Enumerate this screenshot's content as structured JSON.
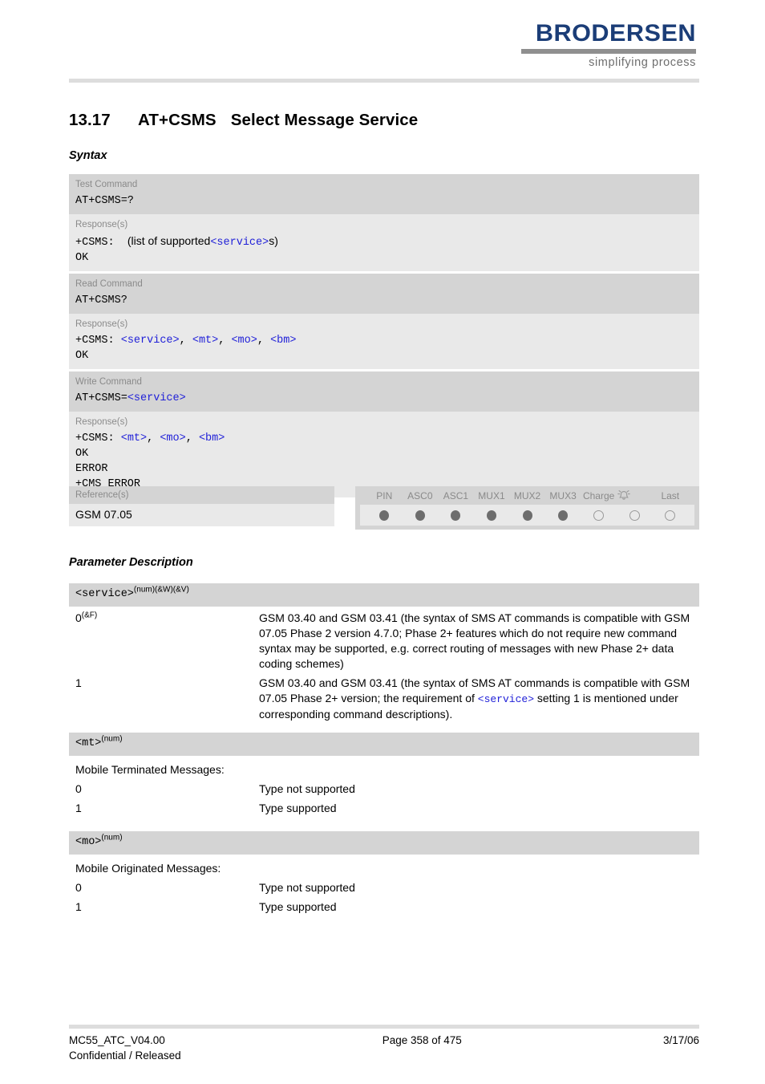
{
  "header": {
    "logo_word": "BRODERSEN",
    "logo_tagline": "simplifying process",
    "brand_color": "#1b3d77"
  },
  "chapter": {
    "number": "13.17",
    "command": "AT+CSMS",
    "title": "Select Message Service"
  },
  "sections": {
    "syntax_heading": "Syntax",
    "parameter_heading": "Parameter Description"
  },
  "syntax": {
    "blocks": [
      {
        "cmd_label": "Test Command",
        "cmd_line": "AT+CSMS=?",
        "resp_label": "Response(s)",
        "resp_lines": [
          "+CSMS:  (list of supported<service>s)",
          "OK"
        ]
      },
      {
        "cmd_label": "Read Command",
        "cmd_line": "AT+CSMS?",
        "resp_label": "Response(s)",
        "resp_lines": [
          "+CSMS: <service>, <mt>, <mo>, <bm>",
          "OK"
        ]
      },
      {
        "cmd_label": "Write Command",
        "cmd_line": "AT+CSMS=<service>",
        "resp_label": "Response(s)",
        "resp_lines": [
          "+CSMS: <mt>, <mo>, <bm>",
          "OK",
          "ERROR",
          "+CMS ERROR"
        ]
      }
    ],
    "test": {
      "label": "Test Command",
      "command": "AT+CSMS=?",
      "resp_label": "Response(s)",
      "line1_prefix": "+CSMS:  ",
      "line1_text": "(list of supported",
      "line1_param": "<service>",
      "line1_suffix": "s)",
      "line2": "OK"
    },
    "read": {
      "label": "Read Command",
      "command": "AT+CSMS?",
      "resp_label": "Response(s)",
      "line1_prefix": "+CSMS: ",
      "p1": "<service>",
      "p2": "<mt>",
      "p3": "<mo>",
      "p4": "<bm>",
      "sep": ", ",
      "line2": "OK"
    },
    "write": {
      "label": "Write Command",
      "command_prefix": "AT+CSMS=",
      "command_param": "<service>",
      "resp_label": "Response(s)",
      "line1_prefix": "+CSMS: ",
      "p1": "<mt>",
      "p2": "<mo>",
      "p3": "<bm>",
      "sep": ", ",
      "line2": "OK",
      "line3": "ERROR",
      "line4": "+CMS ERROR"
    }
  },
  "reference": {
    "label": "Reference(s)",
    "value": "GSM 07.05"
  },
  "attributes": {
    "headers": [
      "PIN",
      "ASC0",
      "ASC1",
      "MUX1",
      "MUX2",
      "MUX3",
      "Charge",
      "alarm-icon",
      "Last"
    ],
    "states": [
      "filled",
      "filled",
      "filled",
      "filled",
      "filled",
      "filled",
      "open",
      "open",
      "open"
    ]
  },
  "parameters": [
    {
      "name": "<service>",
      "superscript": "(num)(&W)(&V)",
      "intro": "",
      "rows": [
        {
          "key": "0",
          "key_sup": "(&F)",
          "value_pre": "GSM 03.40 and GSM 03.41 (the syntax of SMS AT commands is compatible with GSM 07.05 Phase 2 version 4.7.0; Phase 2+ features which do not require new command syntax may be supported, e.g. correct routing of messages with new Phase 2+ data coding schemes)",
          "value_param": "",
          "value_post": ""
        },
        {
          "key": "1",
          "key_sup": "",
          "value_pre": "GSM 03.40 and GSM 03.41 (the syntax of SMS AT commands is compatible with GSM 07.05 Phase 2+ version; the requirement of ",
          "value_param": "<service>",
          "value_post": " setting 1 is mentioned under corresponding command descriptions)."
        }
      ]
    },
    {
      "name": "<mt>",
      "superscript": "(num)",
      "intro": "Mobile Terminated Messages:",
      "rows": [
        {
          "key": "0",
          "key_sup": "",
          "value_pre": "Type not supported",
          "value_param": "",
          "value_post": ""
        },
        {
          "key": "1",
          "key_sup": "",
          "value_pre": "Type supported",
          "value_param": "",
          "value_post": ""
        }
      ]
    },
    {
      "name": "<mo>",
      "superscript": "(num)",
      "intro": "Mobile Originated Messages:",
      "rows": [
        {
          "key": "0",
          "key_sup": "",
          "value_pre": "Type not supported",
          "value_param": "",
          "value_post": ""
        },
        {
          "key": "1",
          "key_sup": "",
          "value_pre": "Type supported",
          "value_param": "",
          "value_post": ""
        }
      ]
    }
  ],
  "footer": {
    "doc_id": "MC55_ATC_V04.00",
    "classification": "Confidential / Released",
    "page": "Page 358 of 475",
    "date": "3/17/06"
  }
}
